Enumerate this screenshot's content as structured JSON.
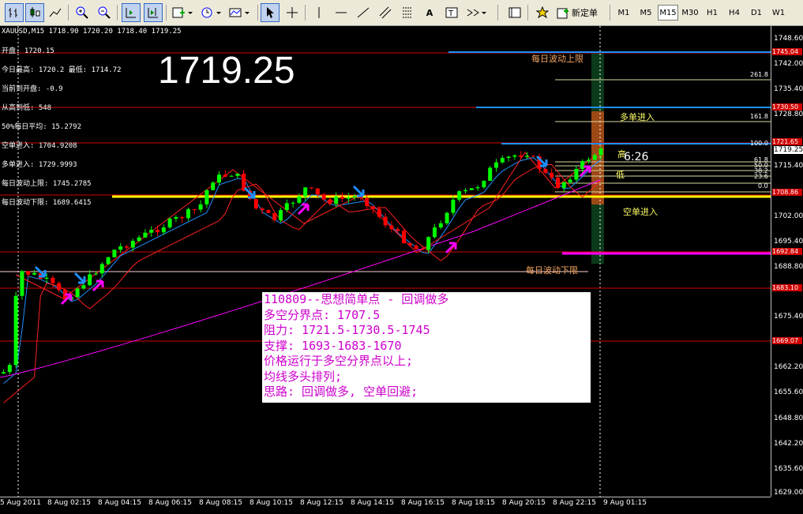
{
  "toolbar": {
    "new_order_label": "新定单",
    "timeframes": [
      "M1",
      "M5",
      "M15",
      "M30",
      "H1",
      "H4",
      "D1",
      "W1"
    ],
    "active_timeframe": "M15"
  },
  "chart": {
    "symbol_header": "XAUUSD,M15 1718.90 1720.20 1718.40 1719.25",
    "big_price": "1719.25",
    "info_lines": [
      "开盘: 1720.15",
      "今日最高: 1720.2  最低: 1714.72",
      "当前到开盘: -0.9",
      "从高到低: 548",
      "50%每日平均: 15.2792",
      "空单进入: 1704.9208",
      "多单进入: 1729.9993",
      "每日波动上限: 1745.2785",
      "每日波动下限: 1689.6415"
    ],
    "labels": {
      "daily_upper": "每日波动上限",
      "daily_lower": "每日波动下限",
      "long_entry": "多单进入",
      "short_entry": "空单进入",
      "high": "高",
      "low": "低",
      "countdown": "6:26"
    },
    "fib_levels": [
      "261.8",
      "161.8",
      "100.0",
      "61.8",
      "50.0",
      "38.2",
      "23.6",
      "0.0"
    ],
    "colors": {
      "bull": "#00ff00",
      "bear": "#ff0000",
      "level_red": "#ff0000",
      "level_blue": "#1e90ff",
      "support_yellow": "#ffff00",
      "magenta": "#ff00ff"
    }
  },
  "note": {
    "lines": [
      "110809--思想简单点 - 回调做多",
      "多空分界点: 1707.5",
      "阻力: 1721.5-1730.5-1745",
      "支撑: 1693-1683-1670",
      "价格运行于多空分界点以上;",
      "均线多头排列;",
      "思路: 回调做多, 空单回避;"
    ]
  },
  "price_axis": {
    "labels": [
      "1748.60",
      "1742.00",
      "1735.40",
      "1728.80",
      "1722.20",
      "1715.40",
      "1708.80",
      "1702.00",
      "1695.40",
      "1688.80",
      "1682.20",
      "1675.40",
      "1668.80",
      "1662.20",
      "1655.60",
      "1648.80",
      "1642.20",
      "1635.60",
      "1629.00"
    ],
    "current_price": "1719.25",
    "tags": [
      "1745.04",
      "1730.50",
      "1721.65",
      "1708.86",
      "1692.84",
      "1683.10",
      "1669.07"
    ]
  },
  "time_axis": {
    "labels": [
      "5 Aug 2011",
      "8 Aug 02:15",
      "8 Aug 04:15",
      "8 Aug 06:15",
      "8 Aug 08:15",
      "8 Aug 10:15",
      "8 Aug 12:15",
      "8 Aug 14:15",
      "8 Aug 16:15",
      "8 Aug 18:15",
      "8 Aug 20:15",
      "8 Aug 22:15",
      "9 Aug 01:15"
    ]
  }
}
